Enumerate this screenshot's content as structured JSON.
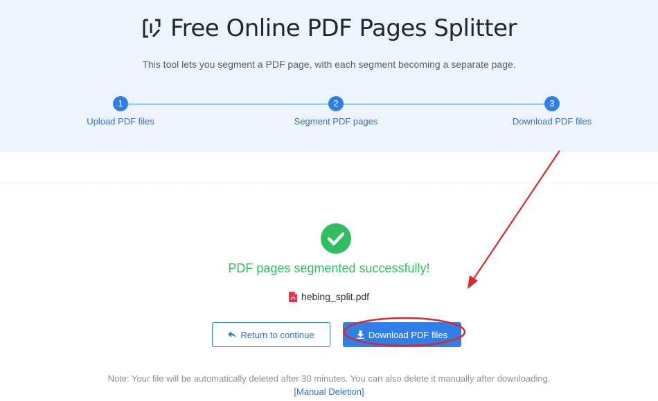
{
  "header": {
    "title": "Free Online PDF Pages Splitter",
    "subtitle": "This tool lets you segment a PDF page, with each segment becoming a separate page.",
    "logo_icon": "split-page-logo-icon"
  },
  "steps": [
    {
      "number": "1",
      "label": "Upload PDF files"
    },
    {
      "number": "2",
      "label": "Segment PDF pages"
    },
    {
      "number": "3",
      "label": "Download PDF files"
    }
  ],
  "result": {
    "status_icon": "check-circle-icon",
    "message": "PDF pages segmented successfully!",
    "file_icon": "pdf-file-icon",
    "file_name": "hebing_split.pdf"
  },
  "actions": {
    "return_label": "Return to continue",
    "return_icon": "reply-arrow-icon",
    "download_label": "Download PDF files",
    "download_icon": "download-icon"
  },
  "footer": {
    "note": "Note: Your file will be automatically deleted after 30 minutes. You can also delete it manually after downloading.",
    "manual_deletion": "[Manual Deletion]"
  },
  "colors": {
    "accent": "#2f7fe8",
    "success": "#2fbf62",
    "annotation": "#e0252b",
    "hero_background": "#eef4fd"
  }
}
